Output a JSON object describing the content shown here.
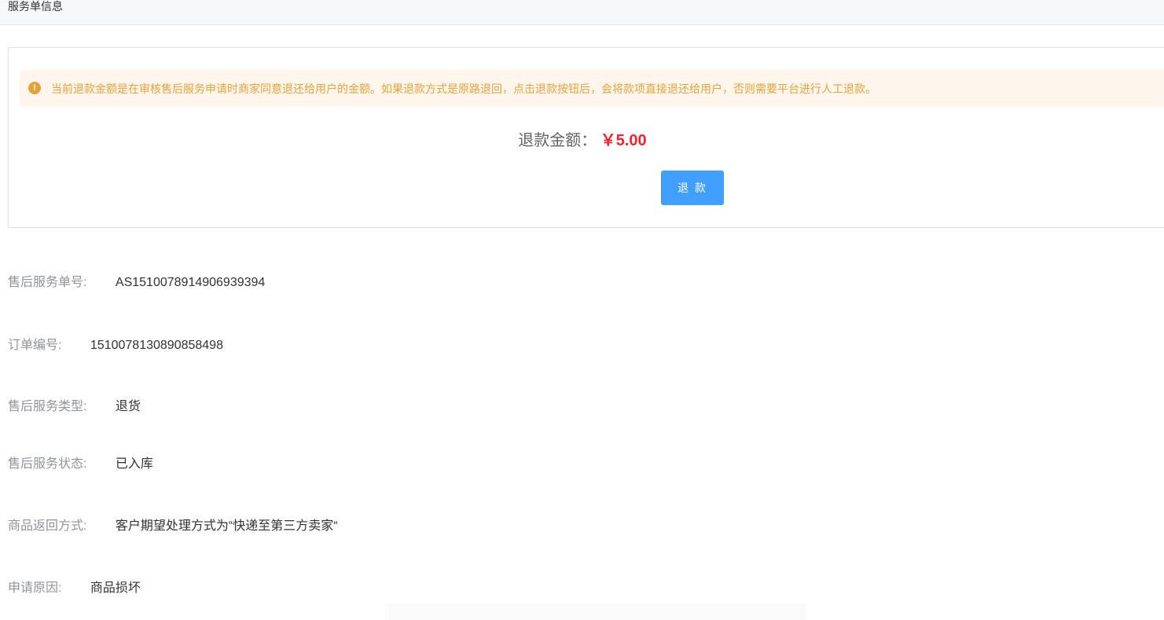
{
  "header": {
    "title": "服务单信息"
  },
  "refund": {
    "notice": "当前退款金额是在审核售后服务申请时商家同意退还给用户的金额。如果退款方式是原路退回，点击退款按钮后，会将款项直接退还给用户，否则需要平台进行人工退款。",
    "amount_label": "退款金额：",
    "amount_value": "￥5.00",
    "button_label": "退 款"
  },
  "info": {
    "service_no_label": "售后服务单号:",
    "service_no": "AS1510078914906939394",
    "order_no_label": "订单编号:",
    "order_no": "1510078130890858498",
    "service_type_label": "售后服务类型:",
    "service_type": "退货",
    "service_status_label": "售后服务状态:",
    "service_status": "已入库",
    "return_method_label": "商品返回方式:",
    "return_method": "客户期望处理方式为“快递至第三方卖家“",
    "reason_label": "申请原因:",
    "reason": "商品损坏"
  },
  "colors": {
    "warning": "#e6a23c",
    "warning_bg": "#fdf6ec",
    "primary": "#409eff",
    "price": "#f5222d"
  }
}
